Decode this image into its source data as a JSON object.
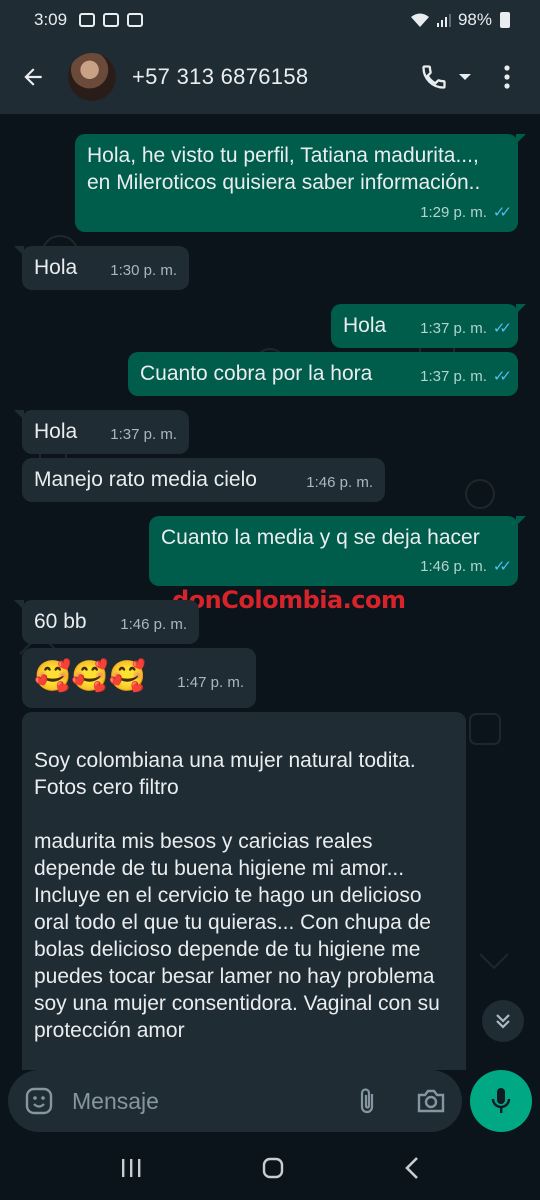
{
  "status_bar": {
    "time": "3:09",
    "battery": "98%"
  },
  "header": {
    "contact": "+57 313 6876158"
  },
  "messages": [
    {
      "dir": "out",
      "text": "Hola, he visto tu perfil, Tatiana madurita..., en Mileroticos quisiera saber información..",
      "time": "1:29 p. m."
    },
    {
      "dir": "in",
      "text": "Hola",
      "time": "1:30 p. m."
    },
    {
      "dir": "out",
      "text": "Hola",
      "time": "1:37 p. m."
    },
    {
      "dir": "out",
      "text": "Cuanto cobra por la hora",
      "time": "1:37 p. m."
    },
    {
      "dir": "in",
      "text": "Hola",
      "time": "1:37 p. m."
    },
    {
      "dir": "in",
      "text": "Manejo rato media cielo",
      "time": "1:46 p. m."
    },
    {
      "dir": "out",
      "text": "Cuanto la media y q se deja hacer",
      "time": "1:46 p. m."
    },
    {
      "dir": "in",
      "text": "60 bb",
      "time": "1:46 p. m."
    },
    {
      "dir": "in",
      "text": "🥰🥰🥰",
      "time": "1:47 p. m."
    },
    {
      "dir": "in",
      "text": "Soy colombiana una mujer natural todita. Fotos cero filtro\n\nmadurita mis besos y caricias reales depende de tu buena higiene mi amor... Incluye en el cervicio te hago un delicioso oral todo el que tu quieras... Con chupa de bolas delicioso depende de tu higiene me puedes tocar besar lamer no hay problema soy una mujer consentidora. Vaginal con su protección amor",
      "time": ""
    }
  ],
  "watermark": "donColombia.com",
  "composer": {
    "placeholder": "Mensaje"
  },
  "colors": {
    "outgoing": "#005c4b",
    "incoming": "#202c33",
    "background": "#0b141a",
    "accent": "#00a884",
    "read_ticks": "#53bdeb"
  },
  "icons": [
    "back-arrow-icon",
    "phone-icon",
    "dropdown-icon",
    "more-vert-icon",
    "emoji-icon",
    "attach-icon",
    "camera-icon",
    "mic-icon",
    "scroll-down-icon"
  ]
}
